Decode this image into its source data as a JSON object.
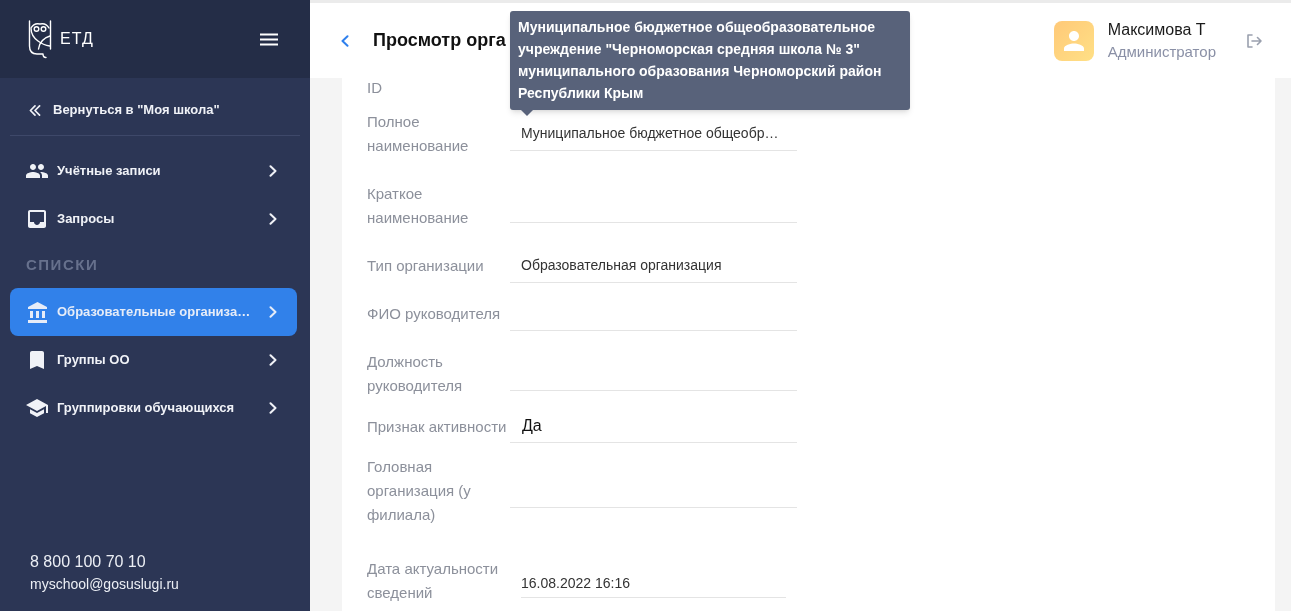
{
  "sidebar": {
    "logo_text": "ЕТД",
    "back_link": "Вернуться в \"Моя школа\"",
    "menu": [
      {
        "label": "Учётные записи",
        "selected": false
      },
      {
        "label": "Запросы",
        "selected": false
      }
    ],
    "section_title": "СПИСКИ",
    "lists": [
      {
        "label": "Образовательные организа…",
        "selected": true
      },
      {
        "label": "Группы ОО",
        "selected": false
      },
      {
        "label": "Группировки обучающихся",
        "selected": false
      }
    ],
    "contacts": {
      "phone": "8 800 100 70 10",
      "email": "myschool@gosuslugi.ru"
    }
  },
  "header": {
    "title": "Просмотр орга",
    "user": {
      "name": "Максимова Т",
      "role": "Администратор"
    }
  },
  "tooltip": {
    "text": "Муниципальное бюджетное общеобразовательное учреждение \"Черноморская средняя школа № 3\" муниципального образования Черноморский район Республики Крым"
  },
  "fields": [
    {
      "label": "ID",
      "kind": "cut"
    },
    {
      "label": "Полное наименование",
      "kind": "text",
      "value": "Муниципальное бюджетное общеобр…"
    },
    {
      "label": "Краткое наименование",
      "kind": "text"
    },
    {
      "label": "Тип организации",
      "kind": "text",
      "value": "Образовательная организация"
    },
    {
      "label": "ФИО руководителя",
      "kind": "text"
    },
    {
      "label": "Должность руководителя",
      "kind": "text"
    },
    {
      "label": "Признак активности",
      "kind": "flag",
      "value": "Да"
    },
    {
      "label": "Головная организация (у филиала)",
      "kind": "text"
    },
    {
      "label": "Дата актуальности сведений",
      "kind": "date",
      "value": "16.08.2022 16:16"
    }
  ]
}
